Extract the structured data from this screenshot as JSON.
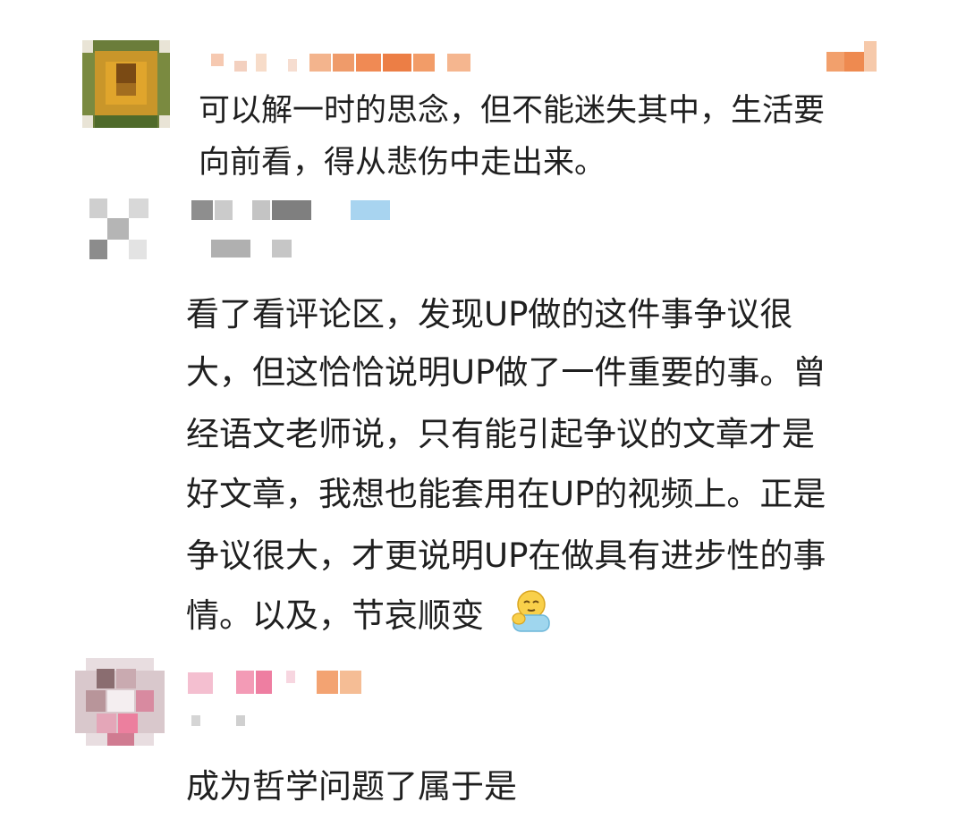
{
  "comments": [
    {
      "username": "",
      "lines": [
        "可以解一时的思念，但不能迷失其中，生活要",
        "向前看，得从悲伤中走出来。"
      ]
    },
    {
      "username": "",
      "lines": [
        "看了看评论区，发现UP做的这件事争议很",
        "大，但这恰恰说明UP做了一件重要的事。曾",
        "经语文老师说，只有能引起争议的文章才是",
        "好文章，我想也能套用在UP的视频上。正是",
        "争议很大，才更说明UP在做具有进步性的事",
        "情。以及，节哀顺变"
      ],
      "emoji": "hug-emoji"
    },
    {
      "username": "",
      "lines": [
        "成为哲学问题了属于是"
      ]
    }
  ],
  "colors": {
    "text": "#1f1f1f",
    "background": "#ffffff"
  }
}
